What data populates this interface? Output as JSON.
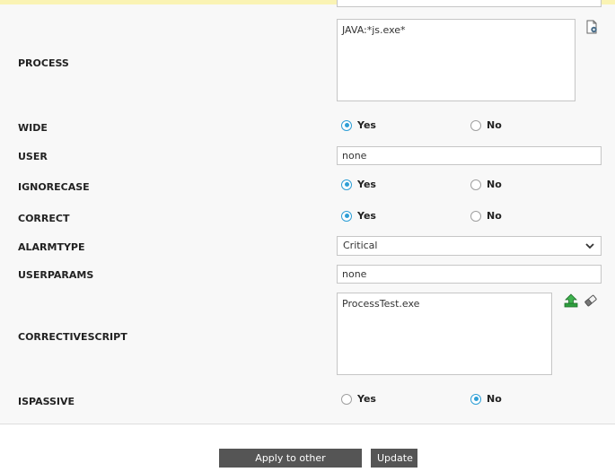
{
  "form": {
    "process": {
      "label": "PROCESS",
      "value": "JAVA:*js.exe*"
    },
    "wide": {
      "label": "WIDE",
      "yes": "Yes",
      "no": "No",
      "selected": "Yes"
    },
    "user": {
      "label": "USER",
      "value": "none"
    },
    "ignorecase": {
      "label": "IGNORECASE",
      "yes": "Yes",
      "no": "No",
      "selected": "Yes"
    },
    "correct": {
      "label": "CORRECT",
      "yes": "Yes",
      "no": "No",
      "selected": "Yes"
    },
    "alarmtype": {
      "label": "ALARMTYPE",
      "value": "Critical"
    },
    "userparams": {
      "label": "USERPARAMS",
      "value": "none"
    },
    "correctivescript": {
      "label": "CORRECTIVESCRIPT",
      "value": "ProcessTest.exe"
    },
    "ispassive": {
      "label": "ISPASSIVE",
      "yes": "Yes",
      "no": "No",
      "selected": "No"
    }
  },
  "footer": {
    "apply_label": "Apply to other components",
    "update_label": "Update"
  },
  "colors": {
    "accent": "#2f9fd6",
    "button_bg": "#555555",
    "top_strip": "#faf3b4",
    "upload_icon": "#2e9e3e"
  },
  "icons": {
    "process_settings": "gear-document-icon",
    "upload": "upload-icon",
    "clear": "eraser-icon",
    "dropdown": "chevron-down-icon"
  }
}
